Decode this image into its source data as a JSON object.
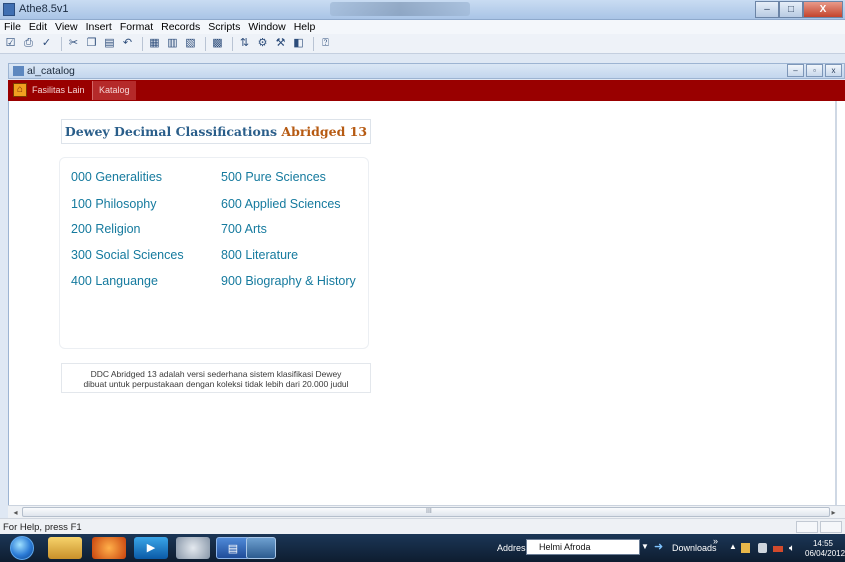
{
  "app": {
    "title": "Athe8.5v1",
    "window_buttons": {
      "minimize": "–",
      "maximize": "□",
      "close": "X"
    }
  },
  "menu": [
    "File",
    "Edit",
    "View",
    "Insert",
    "Format",
    "Records",
    "Scripts",
    "Window",
    "Help"
  ],
  "toolbar_icons": [
    "checkbox-icon",
    "print-icon",
    "spellcheck-icon",
    "cut-icon",
    "copy-icon",
    "paste-icon",
    "undo-icon",
    "new-record-icon",
    "duplicate-record-icon",
    "delete-record-icon",
    "find-icon",
    "sort-icon",
    "browse-icon",
    "layout-icon",
    "preview-icon",
    "help-icon"
  ],
  "child_window": {
    "title": "al_catalog",
    "buttons": {
      "minimize": "–",
      "restore": "▫",
      "close": "x"
    }
  },
  "nav": {
    "tabs": [
      {
        "label": "Fasilitas Lain"
      },
      {
        "label": "Katalog"
      }
    ]
  },
  "ddc": {
    "title_main": "Dewey Decimal Classifications",
    "title_accent": "Abridged 13",
    "classes_left": [
      {
        "label": "000  Generalities"
      },
      {
        "label": "100  Philosophy"
      },
      {
        "label": "200  Religion"
      },
      {
        "label": "300  Social Sciences"
      },
      {
        "label": "400  Languange"
      }
    ],
    "classes_right": [
      {
        "label": "500  Pure Sciences"
      },
      {
        "label": "600  Applied Sciences"
      },
      {
        "label": "700  Arts"
      },
      {
        "label": "800  Literature"
      },
      {
        "label": "900  Biography & History"
      }
    ],
    "note_line1": "DDC Abridged 13  adalah versi sederhana sistem klasifikasi Dewey",
    "note_line2": "dibuat untuk perpustakaan dengan koleksi tidak lebih dari 20.000 judul"
  },
  "scrollbar": {
    "grip": "III"
  },
  "status": {
    "text": "For Help, press F1"
  },
  "taskbar": {
    "address_label": "Address",
    "address_value": "Helmi Afroda",
    "downloads_label": "Downloads",
    "time": "14:55",
    "date": "06/04/2012"
  },
  "colors": {
    "nav_bar": "#990000",
    "link_teal": "#157a9e",
    "title_blue": "#2a5e8a",
    "title_accent": "#b65a12"
  }
}
